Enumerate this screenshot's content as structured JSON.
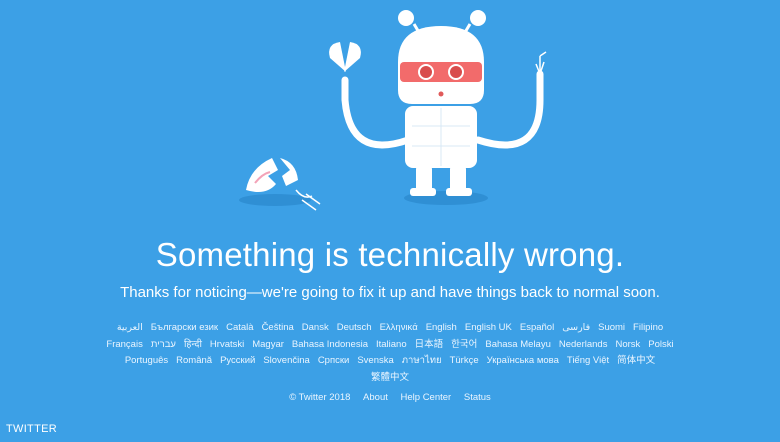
{
  "error": {
    "headline": "Something is technically wrong.",
    "message": "Thanks for noticing—we're going to fix it up and have things back to normal soon."
  },
  "languages": [
    "العربية",
    "Български език",
    "Català",
    "Čeština",
    "Dansk",
    "Deutsch",
    "Ελληνικά",
    "English",
    "English UK",
    "Español",
    "فارسی",
    "Suomi",
    "Filipino",
    "Français",
    "עברית",
    "हिन्दी",
    "Hrvatski",
    "Magyar",
    "Bahasa Indonesia",
    "Italiano",
    "日本語",
    "한국어",
    "Bahasa Melayu",
    "Nederlands",
    "Norsk",
    "Polski",
    "Português",
    "Română",
    "Русский",
    "Slovenčina",
    "Српски",
    "Svenska",
    "ภาษาไทย",
    "Türkçe",
    "Українська мова",
    "Tiếng Việt",
    "简体中文",
    "繁體中文"
  ],
  "footer": {
    "copyright": "© Twitter 2018",
    "about": "About",
    "help": "Help Center",
    "status": "Status"
  },
  "watermark": "TWITTER",
  "colors": {
    "background": "#3ca0e6",
    "robot_body": "#ffffff",
    "robot_visor": "#f26b6b",
    "robot_shadow": "#2f8fd4"
  },
  "illustration": {
    "robot": "broken-robot-icon",
    "egg": "cracked-egg-icon"
  }
}
